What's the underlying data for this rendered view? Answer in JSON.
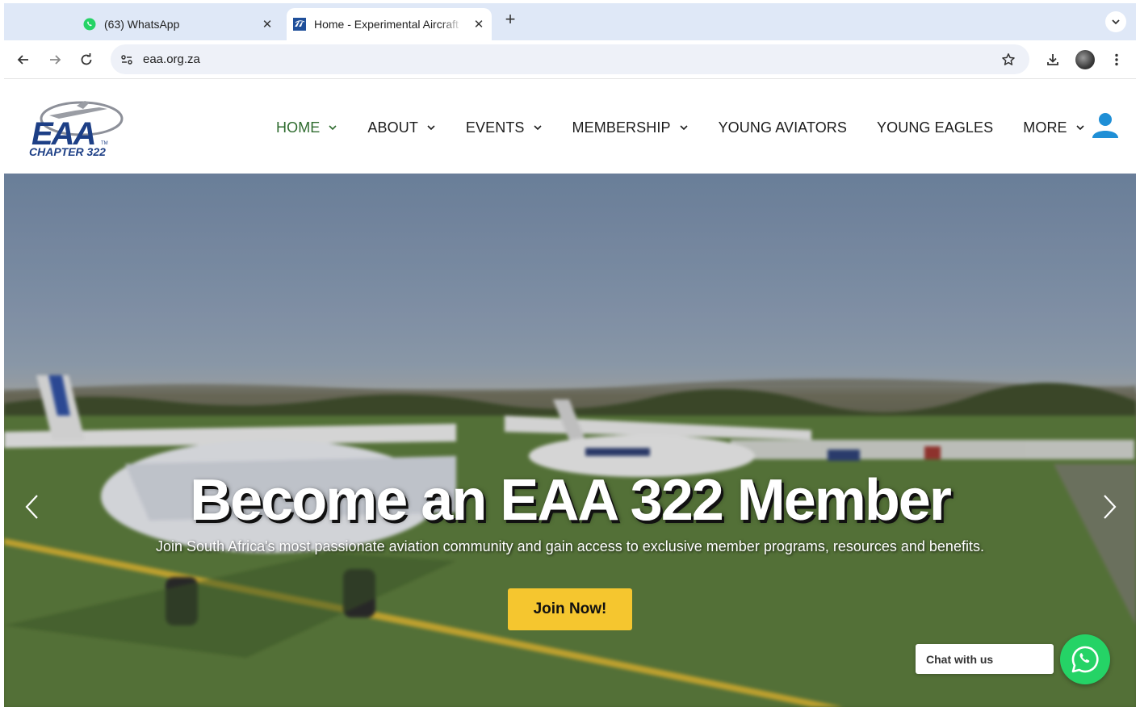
{
  "browser": {
    "tabs": [
      {
        "title": "(63) WhatsApp",
        "icon": "whatsapp-icon",
        "active": false
      },
      {
        "title": "Home - Experimental Aircraft",
        "icon": "eaa-favicon",
        "active": true
      }
    ],
    "url": "eaa.org.za"
  },
  "site": {
    "logo": {
      "mark": "EAA",
      "subtitle": "CHAPTER 322",
      "tm": "TM"
    },
    "nav": [
      {
        "label": "HOME",
        "dropdown": true,
        "active": true
      },
      {
        "label": "ABOUT",
        "dropdown": true
      },
      {
        "label": "EVENTS",
        "dropdown": true
      },
      {
        "label": "MEMBERSHIP",
        "dropdown": true
      },
      {
        "label": "YOUNG AVIATORS",
        "dropdown": false
      },
      {
        "label": "YOUNG EAGLES",
        "dropdown": false
      },
      {
        "label": "MORE",
        "dropdown": true
      }
    ]
  },
  "hero": {
    "title": "Become an EAA 322 Member",
    "subtitle": "Join South Africa's most passionate aviation community and gain access to exclusive member programs, resources and benefits.",
    "cta": "Join Now!"
  },
  "chat": {
    "label": "Chat with us"
  },
  "colors": {
    "active_nav": "#2e6b2e",
    "cta": "#f5c62f",
    "whatsapp": "#25d366",
    "user_icon": "#1f8fd6",
    "tabstrip": "#dfe8f7"
  }
}
